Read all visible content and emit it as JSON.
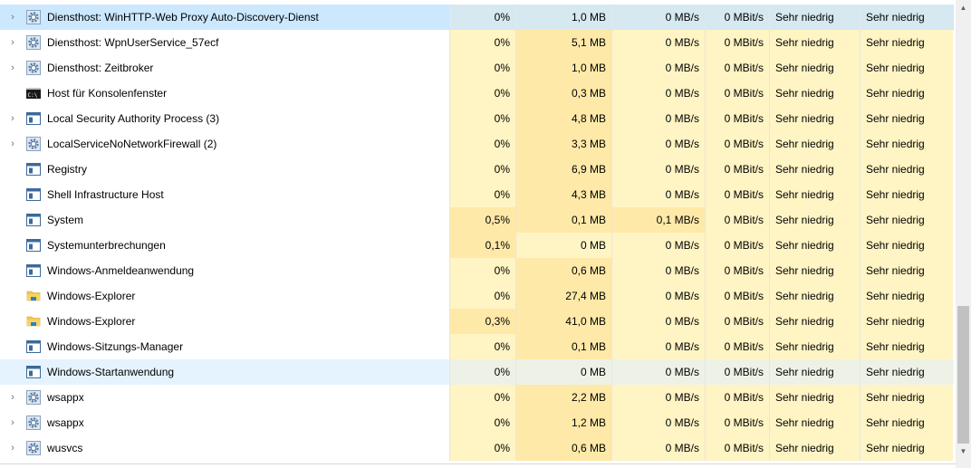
{
  "rows": [
    {
      "name": "Diensthost: WinHTTP-Web Proxy Auto-Discovery-Dienst",
      "icon": "gear-icon",
      "expand": true,
      "cpu": "0%",
      "mem": "1,0 MB",
      "disk": "0 MB/s",
      "net": "0 MBit/s",
      "p1": "Sehr niedrig",
      "p2": "Sehr niedrig",
      "state": "selected"
    },
    {
      "name": "Diensthost: WpnUserService_57ecf",
      "icon": "gear-icon",
      "expand": true,
      "cpu": "0%",
      "mem": "5,1 MB",
      "disk": "0 MB/s",
      "net": "0 MBit/s",
      "p1": "Sehr niedrig",
      "p2": "Sehr niedrig",
      "state": ""
    },
    {
      "name": "Diensthost: Zeitbroker",
      "icon": "gear-icon",
      "expand": true,
      "cpu": "0%",
      "mem": "1,0 MB",
      "disk": "0 MB/s",
      "net": "0 MBit/s",
      "p1": "Sehr niedrig",
      "p2": "Sehr niedrig",
      "state": ""
    },
    {
      "name": "Host für Konsolenfenster",
      "icon": "console-icon",
      "expand": false,
      "cpu": "0%",
      "mem": "0,3 MB",
      "disk": "0 MB/s",
      "net": "0 MBit/s",
      "p1": "Sehr niedrig",
      "p2": "Sehr niedrig",
      "state": ""
    },
    {
      "name": "Local Security Authority Process (3)",
      "icon": "window-icon",
      "expand": true,
      "cpu": "0%",
      "mem": "4,8 MB",
      "disk": "0 MB/s",
      "net": "0 MBit/s",
      "p1": "Sehr niedrig",
      "p2": "Sehr niedrig",
      "state": ""
    },
    {
      "name": "LocalServiceNoNetworkFirewall (2)",
      "icon": "gear-icon",
      "expand": true,
      "cpu": "0%",
      "mem": "3,3 MB",
      "disk": "0 MB/s",
      "net": "0 MBit/s",
      "p1": "Sehr niedrig",
      "p2": "Sehr niedrig",
      "state": ""
    },
    {
      "name": "Registry",
      "icon": "window-icon",
      "expand": false,
      "cpu": "0%",
      "mem": "6,9 MB",
      "disk": "0 MB/s",
      "net": "0 MBit/s",
      "p1": "Sehr niedrig",
      "p2": "Sehr niedrig",
      "state": ""
    },
    {
      "name": "Shell Infrastructure Host",
      "icon": "window-icon",
      "expand": false,
      "cpu": "0%",
      "mem": "4,3 MB",
      "disk": "0 MB/s",
      "net": "0 MBit/s",
      "p1": "Sehr niedrig",
      "p2": "Sehr niedrig",
      "state": ""
    },
    {
      "name": "System",
      "icon": "window-icon",
      "expand": false,
      "cpu": "0,5%",
      "mem": "0,1 MB",
      "disk": "0,1 MB/s",
      "net": "0 MBit/s",
      "p1": "Sehr niedrig",
      "p2": "Sehr niedrig",
      "state": ""
    },
    {
      "name": "Systemunterbrechungen",
      "icon": "window-icon",
      "expand": false,
      "cpu": "0,1%",
      "mem": "0 MB",
      "disk": "0 MB/s",
      "net": "0 MBit/s",
      "p1": "Sehr niedrig",
      "p2": "Sehr niedrig",
      "state": ""
    },
    {
      "name": "Windows-Anmeldeanwendung",
      "icon": "window-icon",
      "expand": false,
      "cpu": "0%",
      "mem": "0,6 MB",
      "disk": "0 MB/s",
      "net": "0 MBit/s",
      "p1": "Sehr niedrig",
      "p2": "Sehr niedrig",
      "state": ""
    },
    {
      "name": "Windows-Explorer",
      "icon": "folder-icon",
      "expand": false,
      "cpu": "0%",
      "mem": "27,4 MB",
      "disk": "0 MB/s",
      "net": "0 MBit/s",
      "p1": "Sehr niedrig",
      "p2": "Sehr niedrig",
      "state": ""
    },
    {
      "name": "Windows-Explorer",
      "icon": "folder-icon",
      "expand": false,
      "cpu": "0,3%",
      "mem": "41,0 MB",
      "disk": "0 MB/s",
      "net": "0 MBit/s",
      "p1": "Sehr niedrig",
      "p2": "Sehr niedrig",
      "state": ""
    },
    {
      "name": "Windows-Sitzungs-Manager",
      "icon": "window-icon",
      "expand": false,
      "cpu": "0%",
      "mem": "0,1 MB",
      "disk": "0 MB/s",
      "net": "0 MBit/s",
      "p1": "Sehr niedrig",
      "p2": "Sehr niedrig",
      "state": ""
    },
    {
      "name": "Windows-Startanwendung",
      "icon": "window-icon",
      "expand": false,
      "cpu": "0%",
      "mem": "0 MB",
      "disk": "0 MB/s",
      "net": "0 MBit/s",
      "p1": "Sehr niedrig",
      "p2": "Sehr niedrig",
      "state": "hover"
    },
    {
      "name": "wsappx",
      "icon": "gear-icon",
      "expand": true,
      "cpu": "0%",
      "mem": "2,2 MB",
      "disk": "0 MB/s",
      "net": "0 MBit/s",
      "p1": "Sehr niedrig",
      "p2": "Sehr niedrig",
      "state": ""
    },
    {
      "name": "wsappx",
      "icon": "gear-icon",
      "expand": true,
      "cpu": "0%",
      "mem": "1,2 MB",
      "disk": "0 MB/s",
      "net": "0 MBit/s",
      "p1": "Sehr niedrig",
      "p2": "Sehr niedrig",
      "state": ""
    },
    {
      "name": "wusvcs",
      "icon": "gear-icon",
      "expand": true,
      "cpu": "0%",
      "mem": "0,6 MB",
      "disk": "0 MB/s",
      "net": "0 MBit/s",
      "p1": "Sehr niedrig",
      "p2": "Sehr niedrig",
      "state": ""
    }
  ],
  "colors": {
    "selected_row": "#cce8ff",
    "hover_row": "#e5f3ff",
    "heat_light": "#fff4c4",
    "heat_medium": "#ffe9a8"
  }
}
